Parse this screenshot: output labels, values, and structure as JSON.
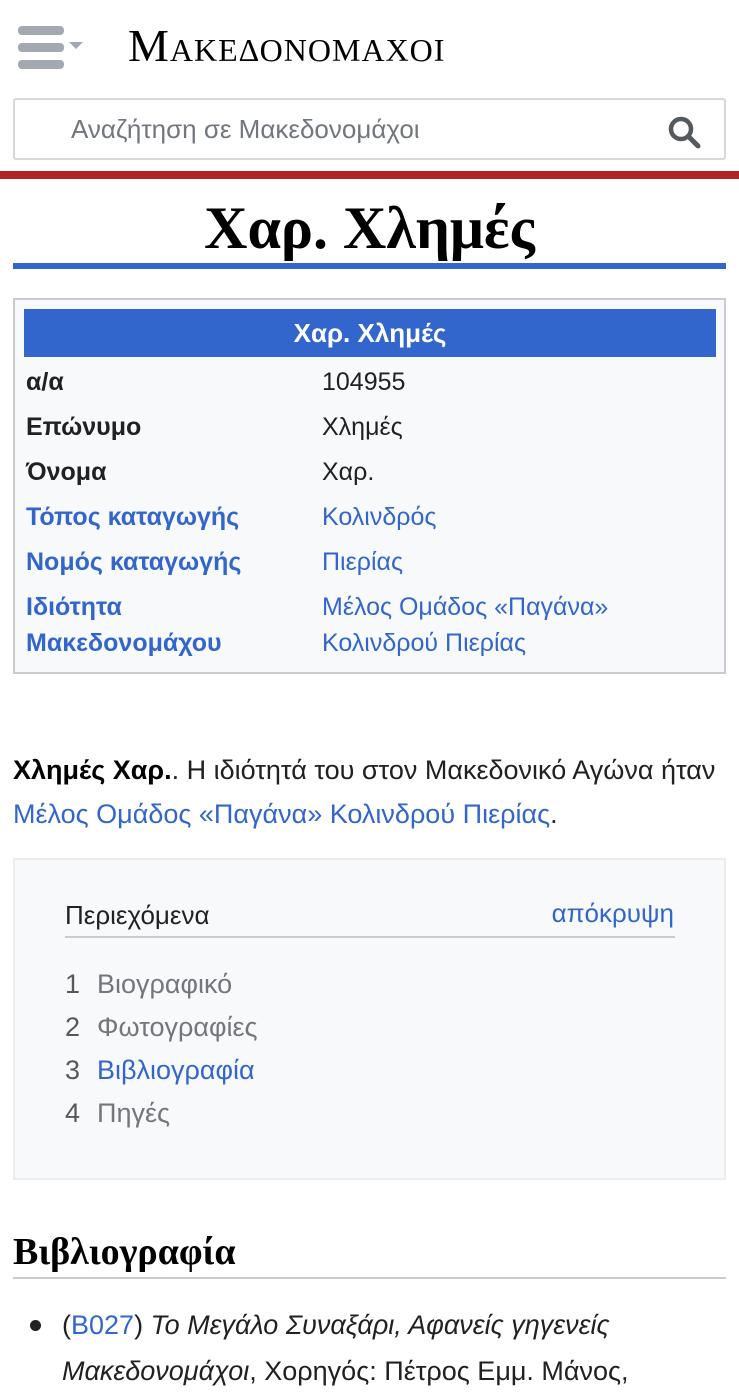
{
  "header": {
    "menu_icon": "hamburger-menu-icon",
    "wordmark": "Μακεδονομαχοι",
    "search_placeholder": "Αναζήτηση σε Μακεδονομάχοι",
    "search_icon": "search-icon"
  },
  "page": {
    "title": "Χαρ. Χλημές"
  },
  "infobox": {
    "heading": "Χαρ. Χλημές",
    "rows": [
      {
        "key": "α/α",
        "value": "104955"
      },
      {
        "key": "Επώνυμο",
        "value": "Χλημές"
      },
      {
        "key": "Όνομα",
        "value": "Χαρ."
      },
      {
        "key": "Τόπος καταγωγής",
        "value": "Κολινδρός"
      },
      {
        "key": "Νομός καταγωγής",
        "value": "Πιερίας"
      },
      {
        "key": "Ιδιότητα Μακεδονομάχου",
        "value": "Μέλος Ομάδος «Παγάνα» Κολινδρού Πιερίας"
      }
    ]
  },
  "lead": {
    "bold_name": "Χλημές Χαρ.",
    "text_1": ". Η ιδιότητά του στον Μακεδονικό Αγώνα ήταν ",
    "link": "Μέλος Ομάδος «Παγάνα» Κολινδρού Πιερίας",
    "text_2": "."
  },
  "toc": {
    "title": "Περιεχόμενα",
    "toggle": "απόκρυψη",
    "items": [
      {
        "num": "1",
        "label": "Βιογραφικό"
      },
      {
        "num": "2",
        "label": "Φωτογραφίες"
      },
      {
        "num": "3",
        "label": "Βιβλιογραφία"
      },
      {
        "num": "4",
        "label": "Πηγές"
      }
    ]
  },
  "bibliography": {
    "heading": "Βιβλιογραφία",
    "paren_open": "(",
    "code": "B027",
    "paren_close": ")",
    "title": "Το Μεγάλο Συναξάρι, Αφανείς γηγενείς Μακεδονομάχοι",
    "rest": ", Χορηγός: Πέτρος Εμμ. Μάνος,"
  },
  "colors": {
    "link": "#3366cc",
    "accent_red": "#b32424",
    "infobox_head": "#3366cc"
  }
}
